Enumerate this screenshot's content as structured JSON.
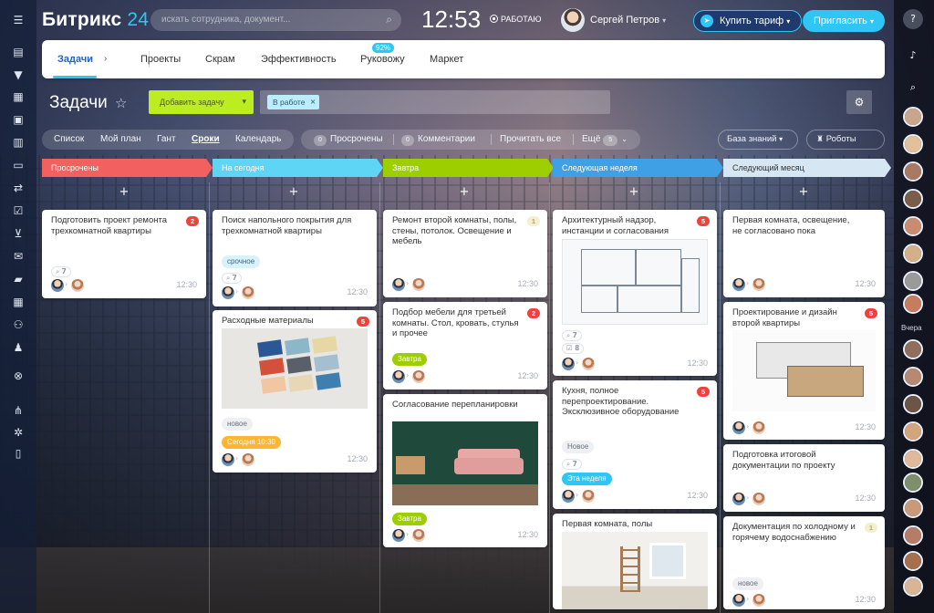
{
  "app": {
    "logo_main": "Битрикс",
    "logo_num": "24"
  },
  "header": {
    "search_placeholder": "искать сотрудника, документ...",
    "clock": "12:53",
    "status": "РАБОТАЮ",
    "user_name": "Сергей Петров",
    "buy_label": "Купить тариф",
    "invite_label": "Пригласить"
  },
  "tabs": {
    "items": [
      "Задачи",
      "Проекты",
      "Скрам",
      "Эффективность",
      "Руковожу",
      "Маркет"
    ],
    "efficiency_badge": "92%"
  },
  "toolbar": {
    "title": "Задачи",
    "add_task": "Добавить задачу",
    "filter_chip": "В работе"
  },
  "views": {
    "items": [
      "Список",
      "Мой план",
      "Гант",
      "Сроки",
      "Календарь"
    ],
    "active": "Сроки"
  },
  "counters": {
    "overdue": "Просрочены",
    "comments": "Комментарии",
    "read_all": "Прочитать все",
    "more": "Ещё",
    "more_count": "5"
  },
  "right_tools": {
    "knowledge": "База знаний",
    "robots": "Роботы"
  },
  "right_sidebar": {
    "yesterday_label": "Вчера"
  },
  "columns": [
    {
      "title": "Просрочены",
      "color": "#f26160"
    },
    {
      "title": "На сегодня",
      "color": "#5fd5f6"
    },
    {
      "title": "Завтра",
      "color": "#9dcf00"
    },
    {
      "title": "Следующая неделя",
      "color": "#3fa0e6"
    },
    {
      "title": "Следующий месяц",
      "color": "#d7e6f3"
    }
  ],
  "cards": {
    "c1": {
      "title": "Подготовить проект ремонта трехкомнатной квартиры",
      "count": "2",
      "files": "7",
      "time": "12:30"
    },
    "c2": {
      "title": "Поиск напольного покрытия для трехкомнатной квартиры",
      "tag": "срочное",
      "files": "7",
      "time": "12:30"
    },
    "c3": {
      "title": "Расходные материалы",
      "count": "5",
      "tag1": "новое",
      "tag2": "Сегодня 10:30",
      "time": "12:30"
    },
    "c4": {
      "title": "Ремонт второй комнаты, полы, стены, потолок. Освещение и мебель",
      "count": "1",
      "time": "12:30"
    },
    "c5": {
      "title": "Подбор мебели для третьей комнаты. Стол, кровать, стулья и прочее",
      "count": "2",
      "tag": "Завтра",
      "time": "12:30"
    },
    "c6": {
      "title": "Согласование перепланировки",
      "tag": "Завтра",
      "time": "12:30"
    },
    "c7": {
      "title": "Архитектурный надзор, инстанции и согласования",
      "count": "5",
      "files": "7",
      "files2": "8",
      "time": "12:30"
    },
    "c8": {
      "title": "Кухня, полное перепроектирование. Эксклюзивное оборудование",
      "count": "5",
      "tag1": "Новое",
      "files": "7",
      "tag2": "Эта неделя",
      "time": "12:30"
    },
    "c9": {
      "title": "Первая комната, полы"
    },
    "c10": {
      "title": "Первая комната, освещение, не согласовано пока",
      "time": "12:30"
    },
    "c11": {
      "title": "Проектирование и дизайн второй квартиры",
      "count": "5",
      "time": "12:30"
    },
    "c12": {
      "title": "Подготовка итоговой документации по проекту",
      "time": "12:30"
    },
    "c13": {
      "title": "Документация по холодному и горячему водоснабжению",
      "count": "1",
      "tag": "новое",
      "time": "12:30"
    }
  }
}
